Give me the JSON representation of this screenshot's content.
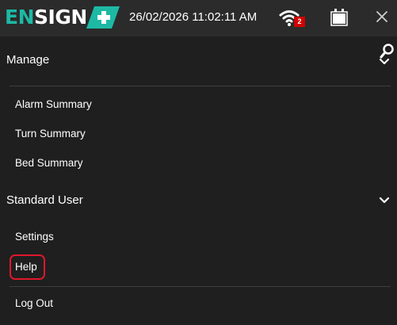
{
  "header": {
    "logo_text_en": "EN",
    "logo_text_sign": "SIGN",
    "datetime": "26/02/2026 11:02:11 AM",
    "wifi_badge": "2",
    "icons": [
      "wifi-icon",
      "battery-icon",
      "close-icon"
    ]
  },
  "sections": {
    "manage": {
      "title": "Manage",
      "icon": "chevron-down-icon"
    },
    "standard_user": {
      "title": "Standard User",
      "icon": "chevron-down-icon"
    }
  },
  "manage_items": [
    "Alarm Summary",
    "Turn Summary",
    "Bed Summary"
  ],
  "user_items": [
    "Settings",
    "Help"
  ],
  "footer_item": "Log Out",
  "search_icon": "search-icon",
  "colors": {
    "brand": "#1db9a5",
    "highlight": "#e0162b",
    "badge": "#d40000",
    "background": "#1f1f1f",
    "header": "#2b2b2b"
  }
}
